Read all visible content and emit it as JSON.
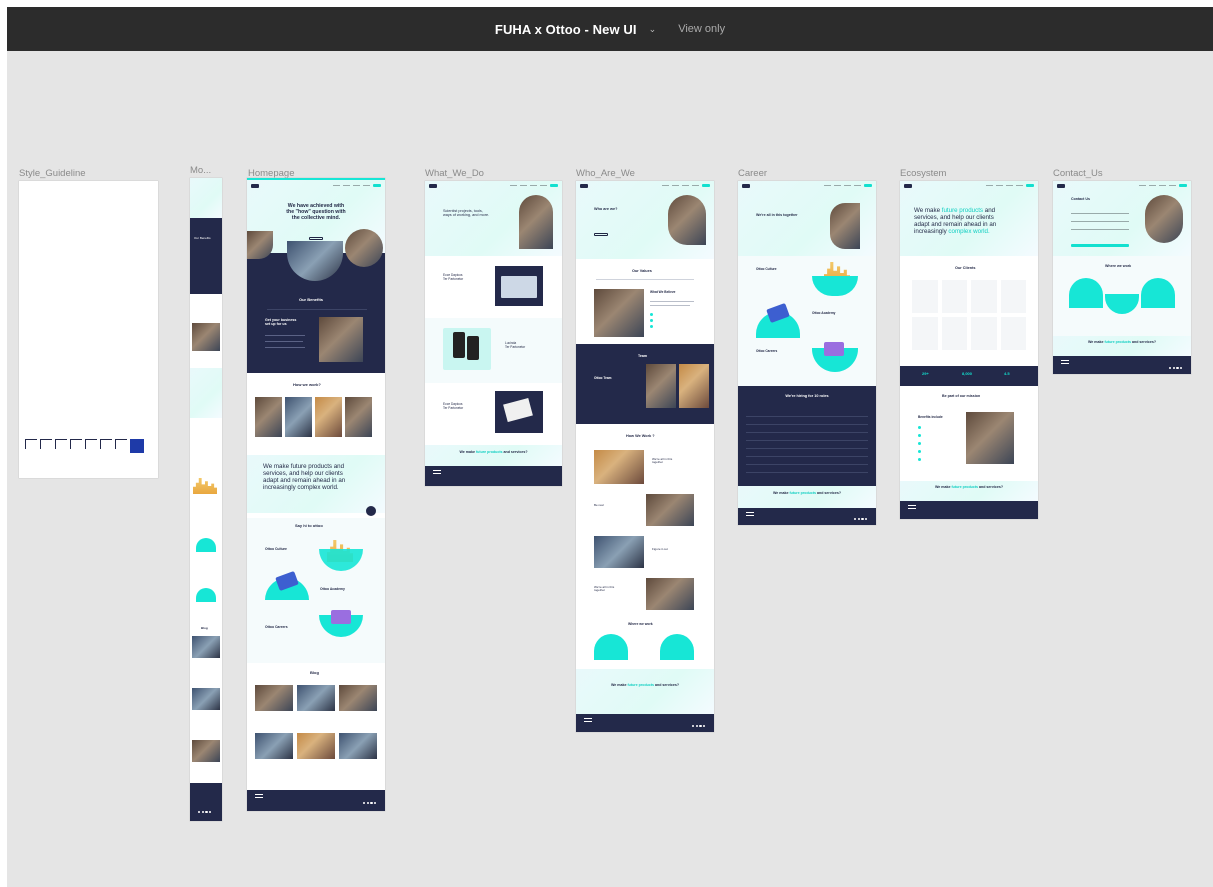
{
  "file": {
    "title": "FUHA x Ottoo - New UI",
    "access_mode": "View only"
  },
  "frames": [
    {
      "label": "Style_Guideline"
    },
    {
      "label": "Mo..."
    },
    {
      "label": "Homepage"
    },
    {
      "label": "What_We_Do"
    },
    {
      "label": "Who_Are_We"
    },
    {
      "label": "Career"
    },
    {
      "label": "Ecosystem"
    },
    {
      "label": "Contact_Us"
    }
  ],
  "frame_content": {
    "homepage": {
      "hero_line1": "We have achieved with",
      "hero_line2": "the \"how\" question with",
      "hero_line3": "the collective mind.",
      "benefits": "Our Benefits",
      "get_business": "Get your business",
      "set_up": "set up for us",
      "how_we_work": "How we work?",
      "big_line1": "We make future products and",
      "big_line2": "services, and help our clients",
      "big_line3": "adapt and remain ahead in an",
      "big_line4": "increasingly complex world.",
      "say_hi": "Say hi to ottoo",
      "culture": "Ottoo Culture",
      "academy": "Ottoo Academy",
      "careers": "Ottoo Careers",
      "blog": "Blog"
    },
    "what_we_do": {
      "hero_line1": "Scientist projects, tools,",
      "hero_line2": "ways of working, and more.",
      "item1a": "Ecce Dapicos",
      "item1b": "Ter Partonetor",
      "item2a": "Lucinda",
      "item2b": "Ter Partonetor",
      "item3a": "Ecce Dapicos",
      "item3b": "Ter Partonetor",
      "cta_a": "We make ",
      "cta_b": "future products",
      "cta_c": " and services?"
    },
    "who_are_we": {
      "hero": "Who are we?",
      "values": "Our Values",
      "believe": "What We Believe",
      "team": "Team",
      "team_sub": "Ottoo Team",
      "how_we_work": "How We Work ?",
      "w1a": "We're all in this",
      "w1b": "together",
      "w2": "Be real",
      "w3": "Figure it out",
      "w4a": "We're all in this",
      "w4b": "together",
      "where": "Where we work",
      "cta_a": "We make ",
      "cta_b": "future products",
      "cta_c": " and services?"
    },
    "career": {
      "hero": "We're all in this together",
      "culture": "Ottoo Culture",
      "academy": "Ottoo Academy",
      "careers": "Ottoo Careers",
      "hiring": "We're hiring for 10 roles",
      "cta_a": "We make ",
      "cta_b": "future products",
      "cta_c": " and services?"
    },
    "ecosystem": {
      "line1a": "We make ",
      "line1b": "future products",
      "line1c": " and",
      "line2": "services, and help our clients",
      "line3": "adapt and remain ahead in an",
      "line4a": "increasingly ",
      "line4b": "complex world.",
      "clients": "Our Clients",
      "stat1": "29+",
      "stat2": "8,000",
      "stat3": "4.5",
      "mission": "Be part of our mission",
      "benefits": "Benefits include",
      "cta_a": "We make ",
      "cta_b": "future products",
      "cta_c": " and services?"
    },
    "contact": {
      "title": "Contact Us",
      "where": "Where we work",
      "cta_a": "We make ",
      "cta_b": "future products",
      "cta_c": " and services?"
    },
    "mobile": {
      "benefits": "Our Benefits",
      "blog": "Blog"
    }
  },
  "colors": {
    "topbar": "#2c2c2c",
    "canvas": "#e5e5e5",
    "navy": "#23294a",
    "turquoise": "#12e0cf"
  }
}
